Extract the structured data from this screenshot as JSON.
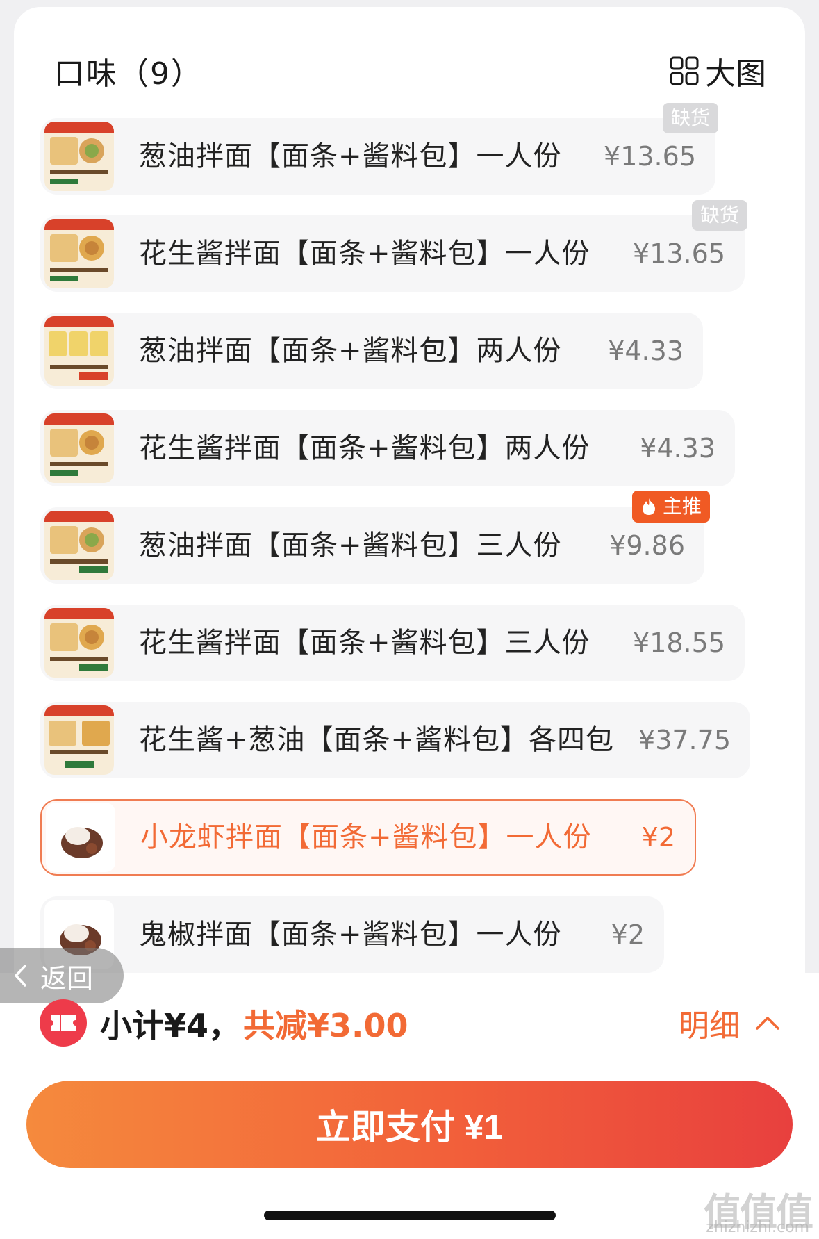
{
  "header": {
    "title": "口味（9）",
    "bigview_label": "大图"
  },
  "options": [
    {
      "name": "葱油拌面【面条+酱料包】一人份",
      "price": "¥13.65",
      "badge": "缺货"
    },
    {
      "name": "花生酱拌面【面条+酱料包】一人份",
      "price": "¥13.65",
      "badge": "缺货"
    },
    {
      "name": "葱油拌面【面条+酱料包】两人份",
      "price": "¥4.33"
    },
    {
      "name": "花生酱拌面【面条+酱料包】两人份",
      "price": "¥4.33"
    },
    {
      "name": "葱油拌面【面条+酱料包】三人份",
      "price": "¥9.86",
      "badge": "主推"
    },
    {
      "name": "花生酱拌面【面条+酱料包】三人份",
      "price": "¥18.55"
    },
    {
      "name": "花生酱+葱油【面条+酱料包】各四包",
      "price": "¥37.75"
    },
    {
      "name": "小龙虾拌面【面条+酱料包】一人份",
      "price": "¥2",
      "selected": true
    },
    {
      "name": "鬼椒拌面【面条+酱料包】一人份",
      "price": "¥2"
    }
  ],
  "back": {
    "label": "返回"
  },
  "summary": {
    "subtotal": "小计¥4，",
    "discount": "共减¥3.00",
    "detail_label": "明细"
  },
  "pay": {
    "label": "立即支付 ¥1"
  },
  "watermark": {
    "main": "值值值",
    "sub": "zhizhizhi.com"
  },
  "colors": {
    "accent": "#f26a35",
    "soldout_badge": "#d9d9db",
    "hot_badge": "#f05a24",
    "pay_gradient_start": "#f58a3d",
    "pay_gradient_end": "#e8403e"
  }
}
